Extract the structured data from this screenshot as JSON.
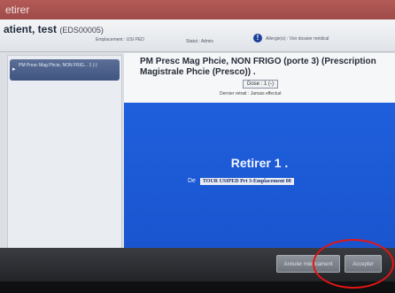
{
  "window": {
    "title": "etirer"
  },
  "header": {
    "patient_name": "atient, test",
    "patient_id": "(EDS00005)",
    "location": "Emplacement : USI PED",
    "status": "Statut : Admis",
    "allergy": "Allergie(s) : Voir dossier médical"
  },
  "sidebar": {
    "items": [
      {
        "label": "PM Presc Mag Phcie, NON FRIG... 1 (-)"
      }
    ]
  },
  "main": {
    "title": "PM Presc Mag Phcie, NON FRIGO (porte 3) (Prescription Magistrale Phcie (Presco)) .",
    "dose": "Dose : 1 (-)",
    "last_removal": "Dernier retrait : Jamais effectué",
    "instruction": "Retirer 1 .",
    "from_label": "De",
    "from_location": "TOUR USIPED Prt 3-Emplacement 08"
  },
  "footer": {
    "cancel_label": "Annuler médicament",
    "accept_label": "Accepter"
  }
}
